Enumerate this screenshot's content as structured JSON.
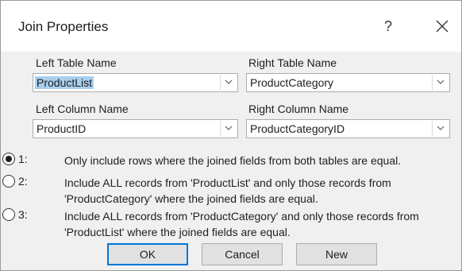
{
  "dialog": {
    "title": "Join Properties",
    "help_label": "?"
  },
  "left_table": {
    "label": "Left Table Name",
    "value": "ProductList"
  },
  "right_table": {
    "label": "Right Table Name",
    "value": "ProductCategory"
  },
  "left_column": {
    "label": "Left Column Name",
    "value": "ProductID"
  },
  "right_column": {
    "label": "Right Column Name",
    "value": "ProductCategoryID"
  },
  "options": [
    {
      "number": "1:",
      "line1": "Only include rows where the joined fields from both tables are equal.",
      "line2": "",
      "selected": true
    },
    {
      "number": "2:",
      "line1": "Include ALL records from 'ProductList' and only those records from",
      "line2": "'ProductCategory' where the joined fields are equal.",
      "selected": false
    },
    {
      "number": "3:",
      "line1": "Include ALL records from 'ProductCategory' and only those records from",
      "line2": "'ProductList' where the joined fields are equal.",
      "selected": false
    }
  ],
  "buttons": {
    "ok": "OK",
    "cancel": "Cancel",
    "new": "New"
  },
  "icons": {
    "close": "close-icon",
    "dropdown": "chevron-down-icon"
  },
  "colors": {
    "accent": "#0078d7",
    "selection": "#a9cfee",
    "dialog_bg": "#f0f0f0"
  }
}
